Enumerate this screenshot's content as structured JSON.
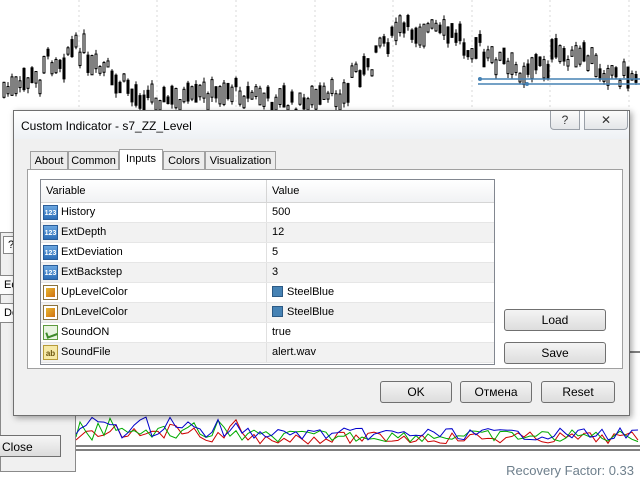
{
  "window": {
    "title": "Custom Indicator - s7_ZZ_Level",
    "help_label": "?",
    "close_label": "✕"
  },
  "tabs": [
    {
      "label": "About",
      "active": false
    },
    {
      "label": "Common",
      "active": false
    },
    {
      "label": "Inputs",
      "active": true
    },
    {
      "label": "Colors",
      "active": false
    },
    {
      "label": "Visualization",
      "active": false
    }
  ],
  "inputs_table": {
    "columns": [
      "Variable",
      "Value"
    ],
    "rows": [
      {
        "variable": "History",
        "value": "500",
        "icon": "int-icon"
      },
      {
        "variable": "ExtDepth",
        "value": "12",
        "icon": "int-icon"
      },
      {
        "variable": "ExtDeviation",
        "value": "5",
        "icon": "int-icon"
      },
      {
        "variable": "ExtBackstep",
        "value": "3",
        "icon": "int-icon"
      },
      {
        "variable": "UpLevelColor",
        "value": "SteelBlue",
        "icon": "color-icon",
        "swatch": "#4682B4"
      },
      {
        "variable": "DnLevelColor",
        "value": "SteelBlue",
        "icon": "color-icon",
        "swatch": "#4682B4"
      },
      {
        "variable": "SoundON",
        "value": "true",
        "icon": "bool-icon"
      },
      {
        "variable": "SoundFile",
        "value": "alert.wav",
        "icon": "string-icon"
      }
    ]
  },
  "icon_text": {
    "int": "123",
    "string": "ab"
  },
  "side_buttons": {
    "load": "Load",
    "save": "Save"
  },
  "footer_buttons": {
    "ok": "OK",
    "cancel": "Отмена",
    "reset": "Reset"
  },
  "background": {
    "help_label": "?",
    "btn1_label": "Ec",
    "btn2_label": "De",
    "close_label": "Close",
    "recovery_factor": "Recovery Factor: 0.33"
  },
  "colors": {
    "steel_blue": "#4682B4",
    "dialog_bg": "#F0F0F0"
  }
}
